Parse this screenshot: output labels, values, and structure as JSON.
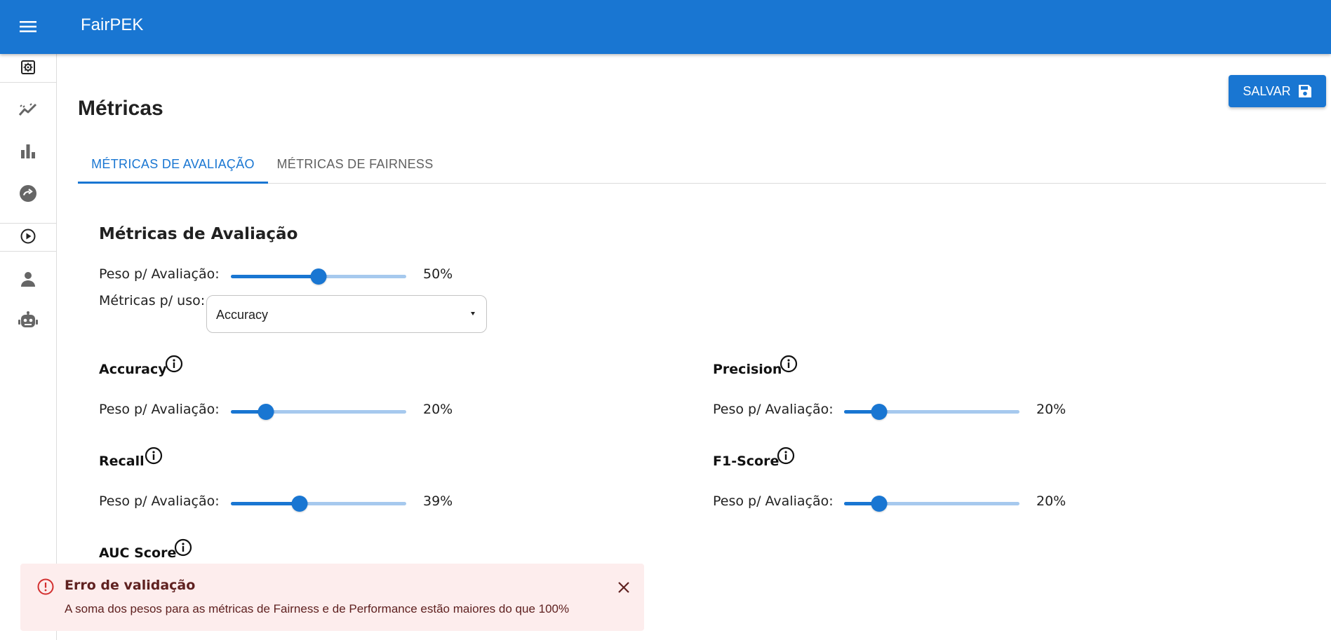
{
  "app": {
    "title": "FairPEK"
  },
  "sidebar": {
    "items": [
      {
        "icon": "settings-box-icon"
      },
      {
        "icon": "trending-chart-icon"
      },
      {
        "icon": "bar-chart-icon"
      },
      {
        "icon": "sync-circle-icon"
      },
      {
        "icon": "play-circle-icon"
      },
      {
        "icon": "person-icon"
      },
      {
        "icon": "robot-icon"
      }
    ]
  },
  "page": {
    "title": "Métricas",
    "save_label": "SALVAR"
  },
  "tabs": [
    {
      "label": "MÉTRICAS DE AVALIAÇÃO",
      "active": true
    },
    {
      "label": "MÉTRICAS DE FAIRNESS",
      "active": false
    }
  ],
  "section": {
    "title": "Métricas de Avaliação",
    "weight_label": "Peso p/ Avaliação:",
    "weight_value": 50,
    "weight_text": "50%",
    "metrics_label": "Métricas p/ uso:",
    "select_value": "Accuracy"
  },
  "metrics": [
    {
      "name": "Accuracy",
      "weight_label": "Peso p/ Avaliação:",
      "value": 20,
      "text": "20%"
    },
    {
      "name": "Precision",
      "weight_label": "Peso p/ Avaliação:",
      "value": 20,
      "text": "20%"
    },
    {
      "name": "Recall",
      "weight_label": "Peso p/ Avaliação:",
      "value": 39,
      "text": "39%"
    },
    {
      "name": "F1-Score",
      "weight_label": "Peso p/ Avaliação:",
      "value": 20,
      "text": "20%"
    },
    {
      "name": "AUC Score"
    }
  ],
  "alert": {
    "title": "Erro de validação",
    "message": "A soma dos pesos para as métricas de Fairness e de Performance estão maiores do que 100%"
  },
  "colors": {
    "primary": "#1976d2",
    "rail": "#a6c9ee",
    "error_bg": "#fdeded",
    "error_text": "#5f2120",
    "error_icon": "#d32f2f"
  }
}
